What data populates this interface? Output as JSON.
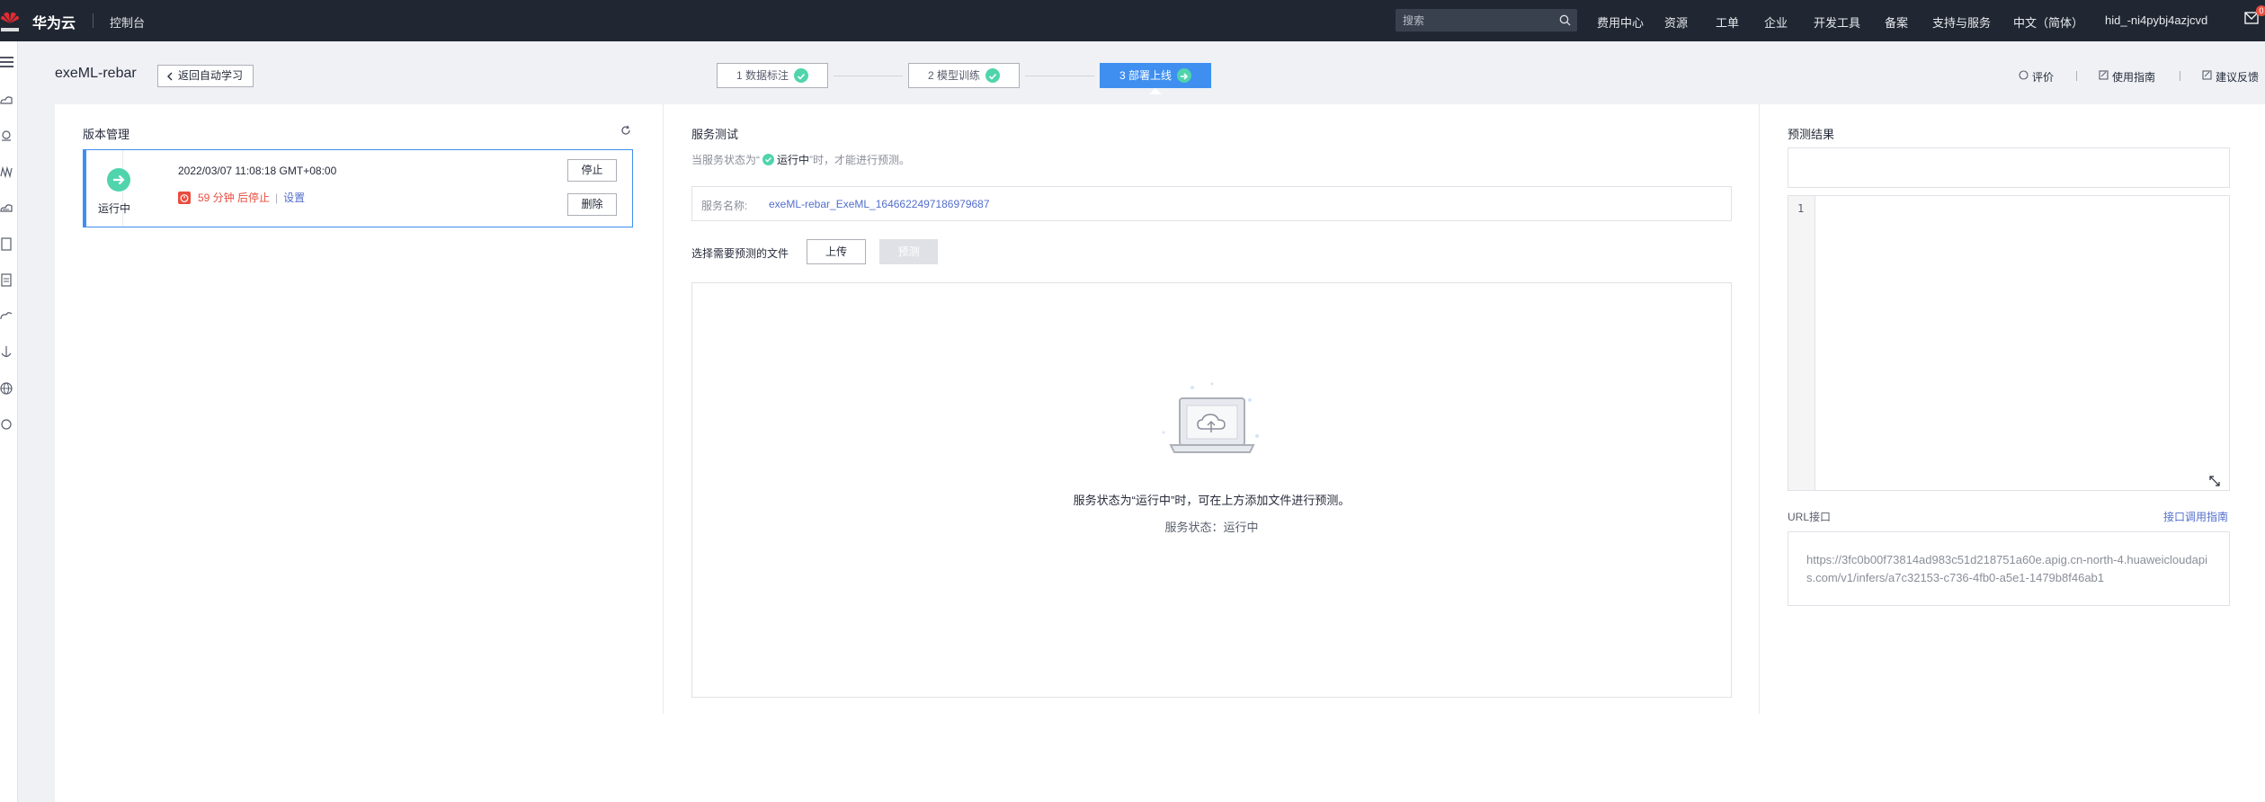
{
  "topbar": {
    "brand": "华为云",
    "console": "控制台",
    "search_placeholder": "搜索",
    "nav": [
      "费用中心",
      "资源",
      "工单",
      "企业",
      "开发工具",
      "备案",
      "支持与服务",
      "中文（简体）",
      "hid_-ni4pybj4azjcvd"
    ],
    "notification_count": "0"
  },
  "header": {
    "title": "exeML-rebar",
    "back_label": "返回自动学习",
    "steps": [
      {
        "label": "1 数据标注",
        "state": "done"
      },
      {
        "label": "2 模型训练",
        "state": "done"
      },
      {
        "label": "3 部署上线",
        "state": "active"
      }
    ],
    "links": {
      "rate": "评价",
      "guide": "使用指南",
      "feedback": "建议反馈"
    }
  },
  "version": {
    "title": "版本管理",
    "status": "运行中",
    "timestamp": "2022/03/07 11:08:18 GMT+08:00",
    "countdown": "59 分钟 后停止",
    "settings": "设置",
    "stop": "停止",
    "delete": "删除"
  },
  "service": {
    "title": "服务测试",
    "hint_prefix": "当服务状态为“",
    "hint_status": "运行中",
    "hint_suffix": "”时，才能进行预测。",
    "name_label": "服务名称:",
    "name_value": "exeML-rebar_ExeML_1646622497186979687",
    "file_label": "选择需要预测的文件",
    "upload": "上传",
    "predict": "预测",
    "drop_message": "服务状态为“运行中”时，可在上方添加文件进行预测。",
    "drop_status": "服务状态：运行中"
  },
  "result": {
    "title": "预测结果",
    "line_number": "1",
    "url_label": "URL接口",
    "url_doc": "接口调用指南",
    "url_value": "https://3fc0b00f73814ad983c51d218751a60e.apig.cn-north-4.huaweicloudapis.com/v1/infers/a7c32153-c736-4fb0-a5e1-1479b8f46ab1"
  },
  "colors": {
    "topbar": "#212732",
    "accent": "#3f8ff0",
    "success": "#50d4ab",
    "danger": "#e84e40",
    "link": "#526ecc"
  }
}
